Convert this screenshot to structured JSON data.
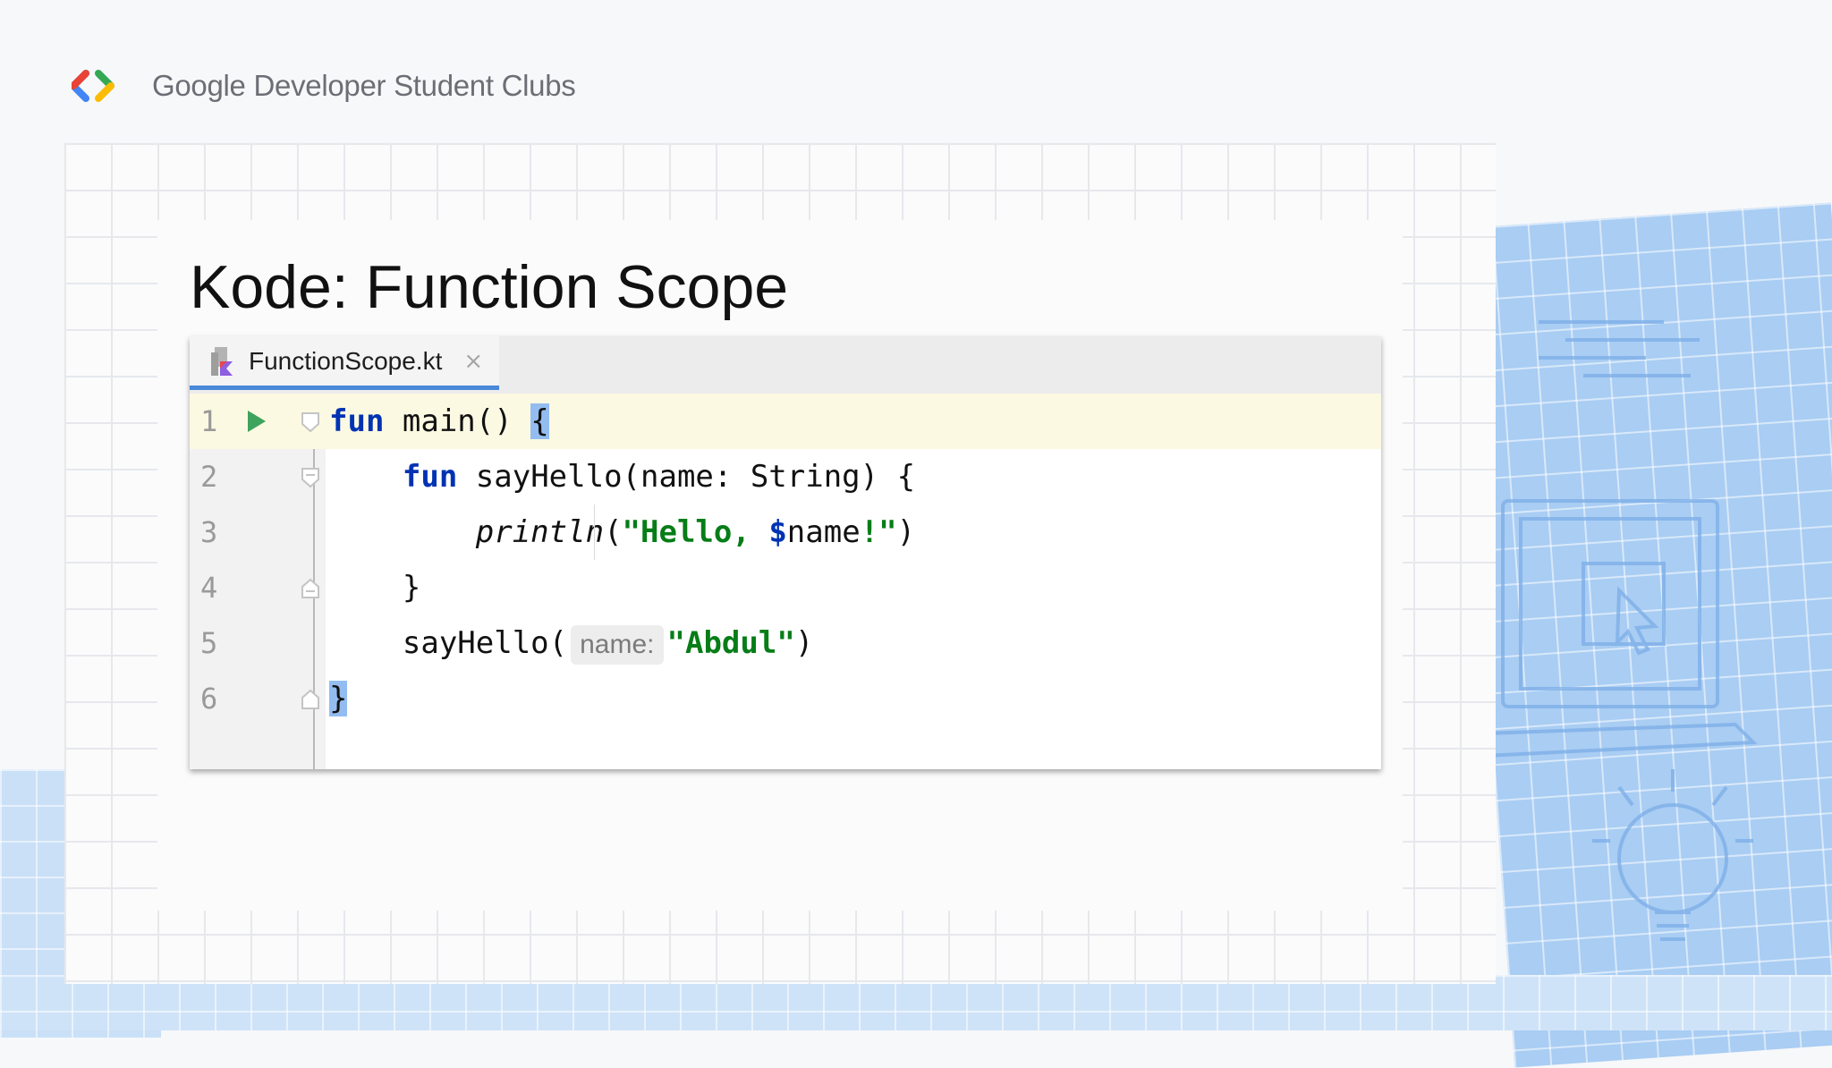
{
  "header": {
    "brand": "Google Developer Student Clubs",
    "logo_colors": [
      "#ea4335",
      "#4285f4",
      "#34a853",
      "#fbbc04"
    ]
  },
  "slide": {
    "title": "Kode: Function Scope"
  },
  "editor": {
    "tab": {
      "filename": "FunctionScope.kt",
      "close_icon": "×"
    },
    "lines": [
      {
        "num": "1",
        "has_run_icon": true
      },
      {
        "num": "2"
      },
      {
        "num": "3"
      },
      {
        "num": "4"
      },
      {
        "num": "5"
      },
      {
        "num": "6"
      }
    ],
    "code": {
      "l1_kw": "fun",
      "l1_rest": " main() ",
      "l1_brace": "{",
      "l2_indent": "    ",
      "l2_kw": "fun",
      "l2_rest": " sayHello(name: String) {",
      "l3_indent": "        ",
      "l3_fn": "println",
      "l3_open": "(",
      "l3_str1": "\"Hello, ",
      "l3_dollar": "$",
      "l3_var": "name",
      "l3_str2": "!\"",
      "l3_close": ")",
      "l4_indent": "    ",
      "l4_brace": "}",
      "l5_indent": "    ",
      "l5_call": "sayHello(",
      "l5_hint": "name:",
      "l5_str": "\"Abdul\"",
      "l5_close": ")",
      "l6_brace": "}"
    }
  },
  "colors": {
    "keyword": "#0033b3",
    "string": "#067d17",
    "current_line": "#fcf9e2",
    "brace_highlight": "#93bdf0",
    "tab_underline": "#4a88da"
  }
}
